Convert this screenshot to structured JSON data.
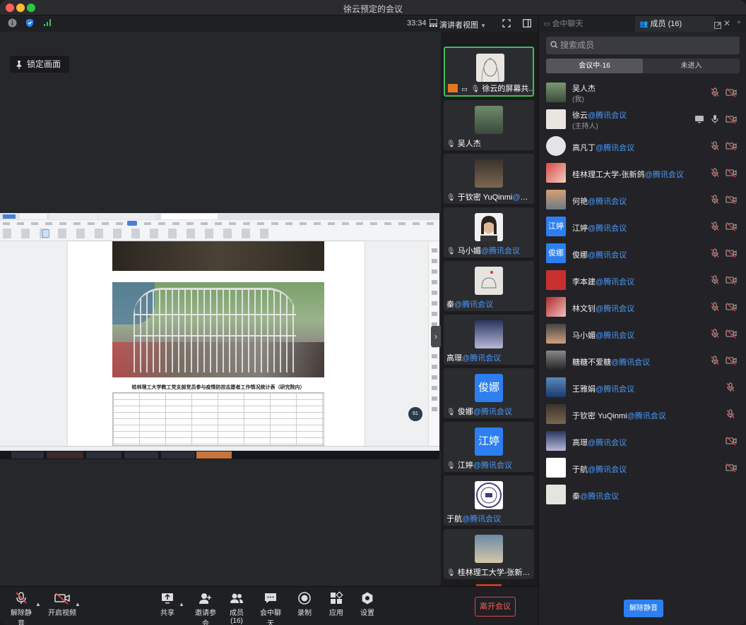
{
  "window": {
    "title": "徐云预定的会议"
  },
  "topbar": {
    "timer": "33:34",
    "view_label": "演讲者视图"
  },
  "stage": {
    "lock_label": "锁定画面"
  },
  "shared_doc": {
    "title": "桂林理工大学教工党支部党员参与疫情防控志愿者工作情况统计表（研究院内）"
  },
  "gallery": {
    "tiles": [
      {
        "name": "徐云的屏幕共...",
        "tag": ""
      },
      {
        "name": "吴人杰",
        "tag": ""
      },
      {
        "name": "于钦密 YuQinmi",
        "tag": "@腾..."
      },
      {
        "name": "马小媚",
        "tag": "@腾讯会议"
      },
      {
        "name": "秦",
        "tag": "@腾讯会议"
      },
      {
        "name": "高璟",
        "tag": "@腾讯会议"
      },
      {
        "name": "俊娜",
        "tag": "@腾讯会议",
        "avatar_text": "俊娜"
      },
      {
        "name": "江婷",
        "tag": "@腾讯会议",
        "avatar_text": "江婷"
      },
      {
        "name": "于航",
        "tag": "@腾讯会议"
      },
      {
        "name": "桂林理工大学-张新鸽...",
        "tag": ""
      }
    ]
  },
  "bottombar": {
    "unmute": "解除静音",
    "video": "开启视频",
    "share": "共享",
    "invite": "邀请参会",
    "members": "成员(16)",
    "chat": "会中聊天",
    "record": "录制",
    "apps": "应用",
    "settings": "设置",
    "leave": "离开会议"
  },
  "panel": {
    "tab_chat": "会中聊天",
    "tab_members": "成员 (16)",
    "search_placeholder": "搜索成员",
    "seg_in": "会议中·16",
    "seg_out": "未进入",
    "unmute_all": "解除静音",
    "members": [
      {
        "name": "吴人杰",
        "tag": "",
        "sub": "(我)"
      },
      {
        "name": "徐云",
        "tag": "@腾讯会议",
        "sub": "(主持人)"
      },
      {
        "name": "高凡丁",
        "tag": "@腾讯会议",
        "sub": ""
      },
      {
        "name": "桂林理工大学-张新鸽",
        "tag": "@腾讯会议",
        "sub": ""
      },
      {
        "name": "何艳",
        "tag": "@腾讯会议",
        "sub": ""
      },
      {
        "name": "江婷",
        "tag": "@腾讯会议",
        "sub": "",
        "avatar_text": "江婷"
      },
      {
        "name": "俊娜",
        "tag": "@腾讯会议",
        "sub": "",
        "avatar_text": "俊娜"
      },
      {
        "name": "李本建",
        "tag": "@腾讯会议",
        "sub": ""
      },
      {
        "name": "林文钊",
        "tag": "@腾讯会议",
        "sub": ""
      },
      {
        "name": "马小媚",
        "tag": "@腾讯会议",
        "sub": ""
      },
      {
        "name": "糖糖不爱糖",
        "tag": "@腾讯会议",
        "sub": ""
      },
      {
        "name": "王雅娟",
        "tag": "@腾讯会议",
        "sub": ""
      },
      {
        "name": "于钦密 YuQinmi",
        "tag": "@腾讯会议",
        "sub": ""
      },
      {
        "name": "高璟",
        "tag": "@腾讯会议",
        "sub": ""
      },
      {
        "name": "于航",
        "tag": "@腾讯会议",
        "sub": ""
      },
      {
        "name": "秦",
        "tag": "@腾讯会议",
        "sub": ""
      }
    ]
  },
  "colors": {
    "accent": "#2d7ff0",
    "active_speaker": "#3bbf5a",
    "leave": "#e04545",
    "muted": "#e04545"
  }
}
